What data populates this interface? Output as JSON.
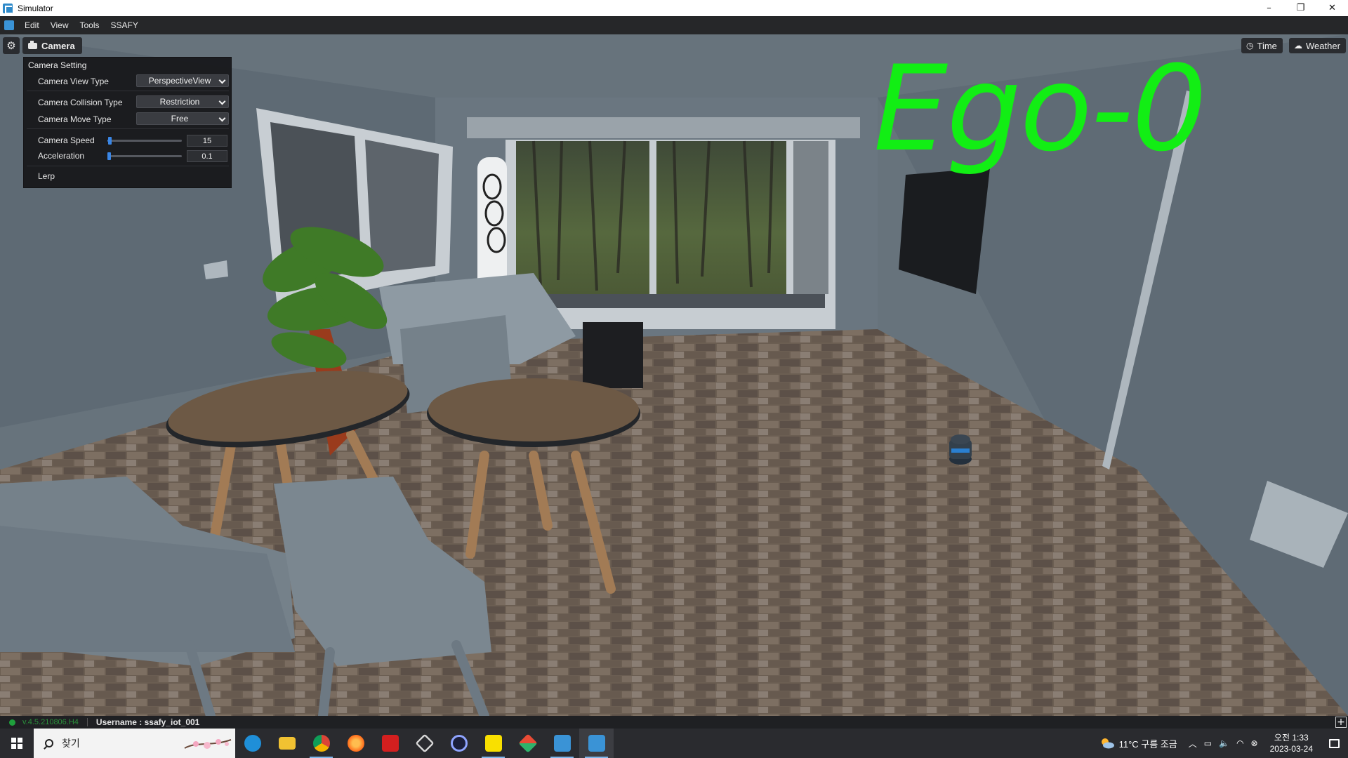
{
  "window": {
    "title": "Simulator",
    "controls": [
      "–",
      "❐",
      "✕"
    ]
  },
  "menu": {
    "items": [
      "Edit",
      "View",
      "Tools",
      "SSAFY"
    ]
  },
  "toolbar": {
    "camera_label": "Camera",
    "time_label": "Time",
    "weather_label": "Weather"
  },
  "camera_setting": {
    "title": "Camera Setting",
    "view_type_label": "Camera View Type",
    "view_type_value": "PerspectiveView",
    "collision_type_label": "Camera Collision Type",
    "collision_type_value": "Restriction",
    "move_type_label": "Camera Move Type",
    "move_type_value": "Free",
    "speed_label": "Camera Speed",
    "speed_value": "15",
    "acceleration_label": "Acceleration",
    "acceleration_value": "0.1",
    "lerp_label": "Lerp"
  },
  "overlay": {
    "ego_label": "Ego-0",
    "ego_color": "#12ee14"
  },
  "status": {
    "version": "v.4.5.210806.H4",
    "username": "Username : ssafy_iot_001"
  },
  "taskbar": {
    "search_text": "찾기",
    "weather_text": "11°C  구름 조금",
    "time": "오전 1:33",
    "date": "2023-03-24",
    "apps": [
      {
        "name": "edge",
        "color": "#1f8fd8"
      },
      {
        "name": "file-explorer",
        "color": "#f1c232"
      },
      {
        "name": "chrome",
        "color": "#4caf50"
      },
      {
        "name": "firefox",
        "color": "#ff7a1a"
      },
      {
        "name": "acrobat",
        "color": "#d31f1f"
      },
      {
        "name": "unity",
        "color": "#d8d8d8"
      },
      {
        "name": "clock-app",
        "color": "#3d5afe"
      },
      {
        "name": "kakaotalk",
        "color": "#f9e000"
      },
      {
        "name": "sourcetree",
        "color": "#2fb36b"
      },
      {
        "name": "simulator-1",
        "color": "#3a93d6"
      },
      {
        "name": "simulator-2",
        "color": "#3a93d6"
      }
    ]
  }
}
